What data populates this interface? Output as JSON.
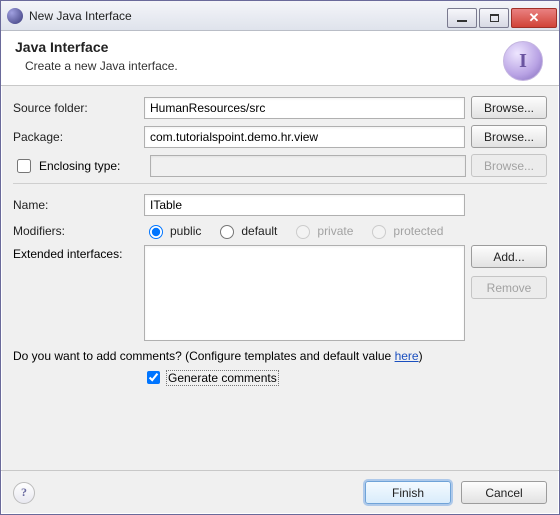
{
  "window": {
    "title": "New Java Interface"
  },
  "banner": {
    "title": "Java Interface",
    "description": "Create a new Java interface.",
    "icon_letter": "I"
  },
  "form": {
    "source_folder": {
      "label": "Source folder:",
      "value": "HumanResources/src",
      "browse": "Browse..."
    },
    "package": {
      "label": "Package:",
      "value": "com.tutorialspoint.demo.hr.view",
      "browse": "Browse..."
    },
    "enclosing": {
      "label": "Enclosing type:",
      "checked": false,
      "value": "",
      "browse": "Browse..."
    },
    "name": {
      "label": "Name:",
      "value": "ITable"
    },
    "modifiers": {
      "label": "Modifiers:",
      "selected": "public",
      "options": {
        "public": "public",
        "default": "default",
        "private": "private",
        "protected": "protected"
      }
    },
    "extended": {
      "label": "Extended interfaces:",
      "items": [],
      "add": "Add...",
      "remove": "Remove"
    },
    "comments": {
      "question_prefix": "Do you want to add comments? (Configure templates and default value ",
      "link": "here",
      "question_suffix": ")",
      "generate_label": "Generate comments",
      "generate_checked": true
    }
  },
  "footer": {
    "finish": "Finish",
    "cancel": "Cancel"
  }
}
